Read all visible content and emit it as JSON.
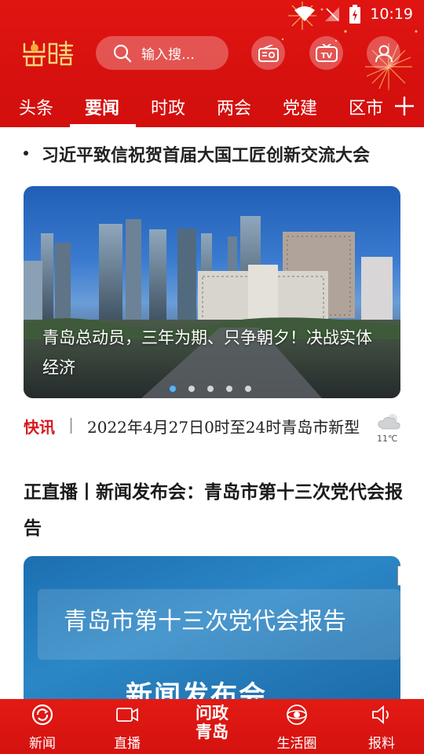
{
  "status_bar": {
    "time": "10:19"
  },
  "header": {
    "logo_text": "崂晴",
    "search_placeholder": "输入搜…",
    "tabs": [
      "头条",
      "要闻",
      "时政",
      "两会",
      "党建",
      "区市"
    ],
    "active_tab": "要闻"
  },
  "headline": {
    "text": "习近平致信祝贺首届大国工匠创新交流大会"
  },
  "carousel": {
    "caption": "青岛总动员，三年为期、只争朝夕！决战实体经济",
    "slide_count": 5,
    "active_index": 0
  },
  "flash": {
    "label": "快讯",
    "text": "2022年4月27日0时至24时青岛市新型",
    "temperature": "11℃"
  },
  "article": {
    "title": "正直播丨新闻发布会：青岛市第十三次党代会报告",
    "image_text": "青岛市第十三次党代会报告",
    "image_subtext": "新闻发布会"
  },
  "bottom_nav": {
    "items": [
      "新闻",
      "直播",
      "生活圈",
      "报料"
    ],
    "center_line1": "问政",
    "center_line2": "青岛"
  },
  "colors": {
    "brand_red": "#d5100e",
    "flash_red": "#d6191d",
    "active_dot": "#4fb7ff"
  },
  "icons": [
    "wifi-icon",
    "signal-icon",
    "battery-icon",
    "search-icon",
    "radio-icon",
    "tv-icon",
    "user-icon",
    "plus-icon",
    "weather-icon",
    "news-icon",
    "video-icon",
    "life-circle-icon",
    "report-icon"
  ]
}
